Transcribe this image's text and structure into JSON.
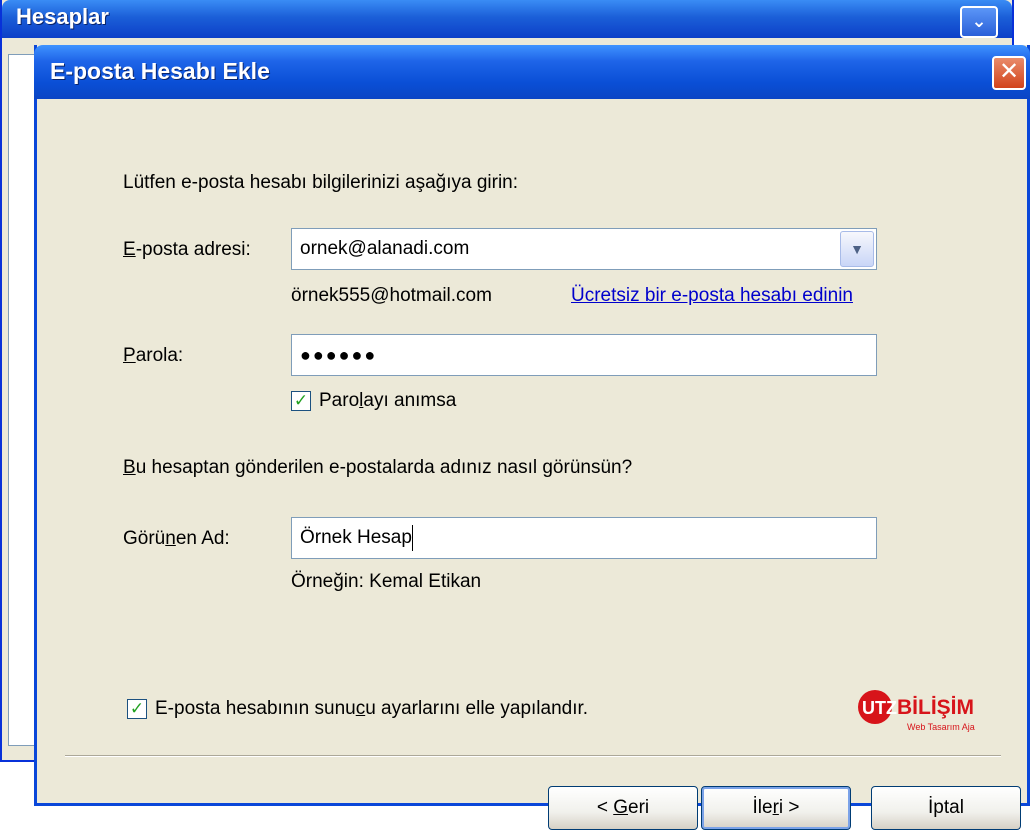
{
  "background_window": {
    "title": "Hesaplar"
  },
  "dialog": {
    "title": "E-posta Hesabı Ekle",
    "intro": "Lütfen e-posta hesabı bilgilerinizi aşağıya girin:",
    "email": {
      "label_u": "E",
      "label_rest": "-posta adresi:",
      "value": "ornek@alanadi.com",
      "example": "örnek555@hotmail.com",
      "free_link": "Ücretsiz bir e-posta hesabı edinin"
    },
    "password": {
      "label_u": "P",
      "label_rest": "arola:",
      "value": "●●●●●●"
    },
    "remember": {
      "label_a": "Paro",
      "label_u": "l",
      "label_b": "ayı anımsa",
      "checked": true
    },
    "display_prompt": {
      "label_u": "B",
      "label_rest": "u hesaptan gönderilen e-postalarda adınız nasıl görünsün?"
    },
    "display_name": {
      "label_a": "Görü",
      "label_u": "n",
      "label_b": "en Ad:",
      "value": "Örnek Hesap",
      "example": "Örneğin: Kemal Etikan"
    },
    "manual_config": {
      "label_a": "E-posta hesabının sunu",
      "label_u": "c",
      "label_b": "u ayarlarını elle yapılandır.",
      "checked": true
    },
    "logo": {
      "brand_a": "UTZ",
      "brand_b": "BİLİŞİM",
      "tagline": "Web Tasarım Ajansı",
      "color": "#d7141a"
    },
    "buttons": {
      "back_a": "< ",
      "back_u": "G",
      "back_b": "eri",
      "next_a": "İle",
      "next_u": "r",
      "next_b": "i >",
      "cancel": "İptal"
    }
  }
}
